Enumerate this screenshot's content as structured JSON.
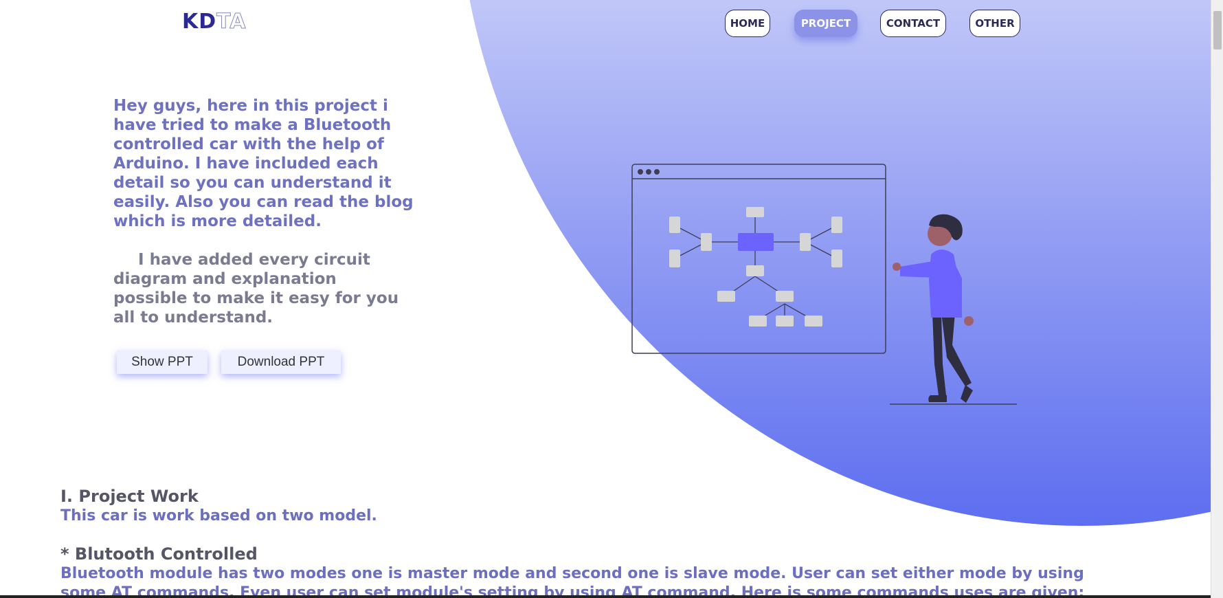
{
  "header": {
    "logo_part1": "KD",
    "logo_part2": "TA",
    "nav": [
      {
        "label": "HOME"
      },
      {
        "label": "PROJECT",
        "active": true
      },
      {
        "label": "CONTACT"
      },
      {
        "label": "OTHER"
      }
    ]
  },
  "intro": {
    "paragraph1": "Hey guys, here in this project i have tried to make a Bluetooth controlled car with the help of Arduino. I have included each detail so you can understand it easily. Also you can read the blog which is more detailed.",
    "paragraph2": "I have added every circuit diagram and explanation possible to make it easy for you all to understand.",
    "show_ppt": "Show PPT",
    "download_ppt": "Download PPT"
  },
  "sections": {
    "project_work_title": "I. Project Work",
    "project_work_text": "This car is work based on two model.",
    "bluetooth_title": "* Blutooth Controlled",
    "bluetooth_text1": "Bluetooth module has two modes one is master mode and second one is slave mode. User can set either mode by using",
    "bluetooth_text2": "some AT commands. Even user can set module's setting by using AT command. Here is some commands uses are given:"
  },
  "colors": {
    "accent": "#6c63ff",
    "gradient_end": "#5d6ef0",
    "text_purple": "#6c6fbf",
    "logo_dark": "#2a2a92"
  }
}
